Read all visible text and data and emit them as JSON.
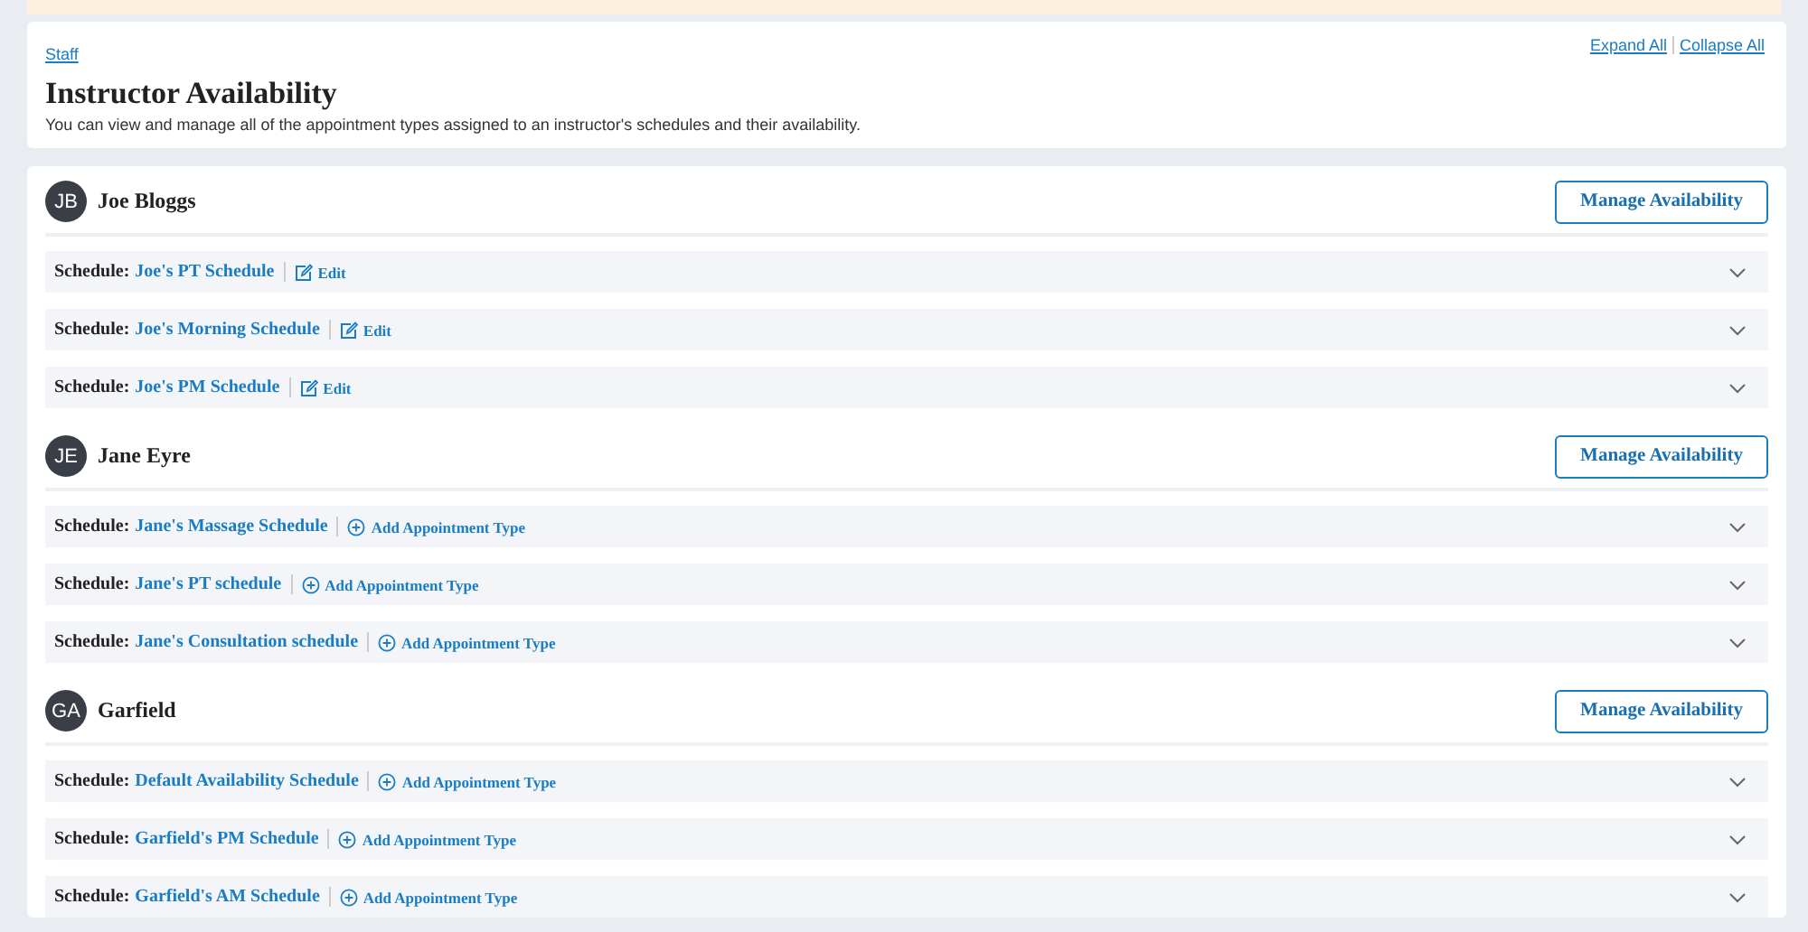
{
  "breadcrumb": "Staff",
  "title": "Instructor Availability",
  "description": "You can view and manage all of the appointment types assigned to an instructor's schedules and their availability.",
  "header_links": [
    "Expand All",
    "Collapse All"
  ],
  "instructors": [
    {
      "initials": "JB",
      "name": "Joe Bloggs",
      "button": "Manage Availability",
      "schedules": [
        {
          "label": "Schedule:",
          "name": "Joe's PT Schedule",
          "kind": "edit",
          "action": "Edit"
        },
        {
          "label": "Schedule:",
          "name": "Joe's Morning Schedule",
          "kind": "edit",
          "action": "Edit"
        },
        {
          "label": "Schedule:",
          "name": "Joe's PM Schedule",
          "kind": "edit",
          "action": "Edit"
        }
      ]
    },
    {
      "initials": "JE",
      "name": "Jane Eyre",
      "button": "Manage Availability",
      "schedules": [
        {
          "label": "Schedule:",
          "name": "Jane's Massage Schedule",
          "kind": "add",
          "action": "Add Appointment Type"
        },
        {
          "label": "Schedule:",
          "name": "Jane's PT schedule",
          "kind": "add",
          "action": "Add Appointment Type"
        },
        {
          "label": "Schedule:",
          "name": "Jane's Consultation schedule",
          "kind": "add",
          "action": "Add Appointment Type"
        }
      ]
    },
    {
      "initials": "GA",
      "name": "Garfield",
      "button": "Manage Availability",
      "schedules": [
        {
          "label": "Schedule:",
          "name": "Default Availability Schedule",
          "kind": "add",
          "action": "Add Appointment Type"
        },
        {
          "label": "Schedule:",
          "name": "Garfield's PM Schedule",
          "kind": "add",
          "action": "Add Appointment Type"
        },
        {
          "label": "Schedule:",
          "name": "Garfield's AM Schedule",
          "kind": "add",
          "action": "Add Appointment Type"
        }
      ]
    }
  ]
}
